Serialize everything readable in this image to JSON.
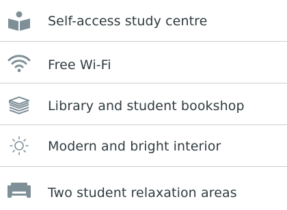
{
  "colors": {
    "icon": "#7f8f98",
    "text": "#2f3a3f",
    "divider": "#c9ced1"
  },
  "features": [
    {
      "icon": "person-reading-icon",
      "label": "Self-access study centre"
    },
    {
      "icon": "wifi-icon",
      "label": "Free Wi-Fi"
    },
    {
      "icon": "books-icon",
      "label": "Library and student bookshop"
    },
    {
      "icon": "sun-icon",
      "label": "Modern and bright interior"
    },
    {
      "icon": "sofa-icon",
      "label": "Two student relaxation areas"
    }
  ]
}
